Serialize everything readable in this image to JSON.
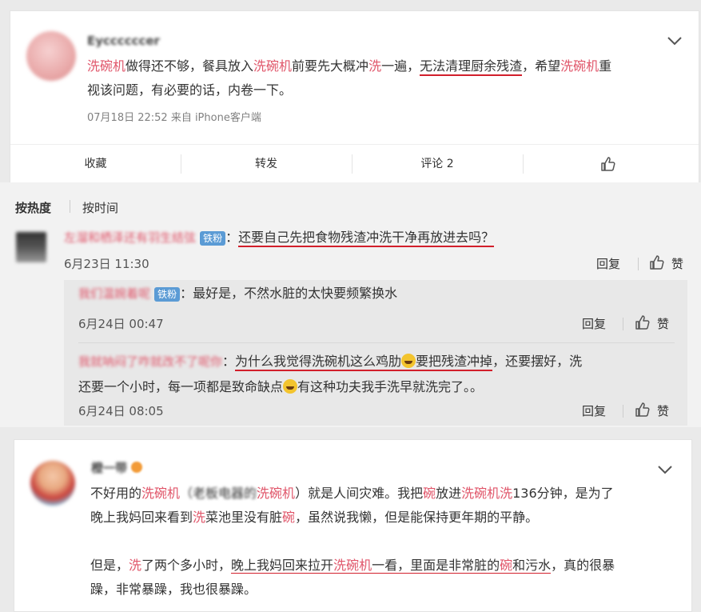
{
  "post": {
    "username": "Eyccccccer",
    "segments": [
      {
        "t": "洗碗机",
        "s": "red"
      },
      {
        "t": "做得还不够，餐具放入",
        "s": ""
      },
      {
        "t": "洗碗机",
        "s": "red"
      },
      {
        "t": "前要先大概冲",
        "s": ""
      },
      {
        "t": "洗",
        "s": "red"
      },
      {
        "t": "一遍，",
        "s": ""
      }
    ],
    "underlined": "无法清理厨余残渣",
    "after": "，希望",
    "hl2": "洗碗机",
    "tail": "重",
    "line2": "视该问题，有必要的话，内卷一下。",
    "time_source": "07月18日 22:52  来自 iPhone客户端",
    "actions": {
      "favorite": "收藏",
      "repost": "转发",
      "comment": "评论 2"
    }
  },
  "sort": {
    "hot": "按热度",
    "time": "按时间"
  },
  "comment1": {
    "username": "左溜和栖泽还有羽生结弦",
    "badge": "铁粉",
    "colon": "：",
    "text": "还要自己先把食物残渣冲洗干净再放进去吗？",
    "time": "6月23日 11:30",
    "reply": "回复",
    "like": "赞"
  },
  "reply1": {
    "username": "我们温婉着呢",
    "badge": "铁粉",
    "text": "：最好是，不然水脏的太快要频繁换水",
    "time": "6月24日 00:47",
    "reply": "回复",
    "like": "赞"
  },
  "reply2": {
    "username": "我就呐闷了咋就改不了呢你",
    "colon": "：",
    "u1": "为什么我觉得洗碗机这么鸡肋",
    "u2": "要把残渣冲掉",
    "rest1": "，还要摆好，洗",
    "line2a": "还要一个小时，每一项都是致命缺点",
    "line2b": "有这种功夫我手洗早就洗完了。。",
    "time": "6月24日 08:05",
    "reply": "回复",
    "like": "赞"
  },
  "post2": {
    "username": "橙一带",
    "l1a": "不好用的",
    "l1b": "洗碗机",
    "l1c": "（老板电器的",
    "l1d": "洗碗机",
    "l1e": "）就是人间灾难。我把",
    "l1f": "碗",
    "l1g": "放进",
    "l1h": "洗碗机洗",
    "l1i": "136分钟，是为了",
    "l2a": "晚上我妈回来看到",
    "l2b": "洗",
    "l2c": "菜池里没有脏",
    "l2d": "碗",
    "l2e": "，虽然说我懒，但是能保持更年期的平静。",
    "l3a": "但是，",
    "l3b": "洗",
    "l3c": "了两个多小时，",
    "l3u1": "晚上我妈回来拉开",
    "l3u2": "洗碗机",
    "l3u3": "一看，里面是非常脏的",
    "l3u4": "碗",
    "l3u5": "和污水",
    "l3d": "，真的很暴",
    "l4": "躁，非常暴躁，我也很暴躁。"
  },
  "colors": {
    "accent_red": "#e0566a",
    "underline_red": "#d21f2b",
    "badge_blue": "#5b9bd5"
  }
}
